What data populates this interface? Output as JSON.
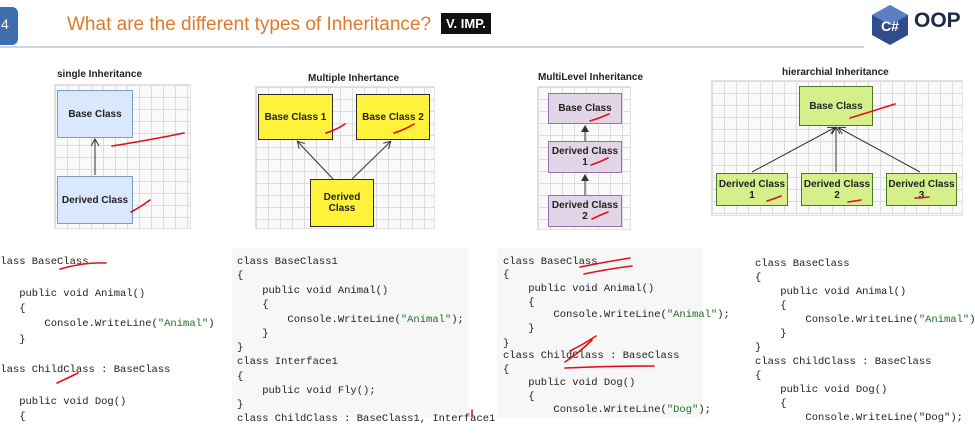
{
  "header": {
    "slide_number": "4",
    "title": "What are the different types of Inheritance?",
    "badge": "V. IMP.",
    "logo_letter": "C#",
    "logo_text": "OOP"
  },
  "diagrams": {
    "single": {
      "title": "single Inheritance",
      "base": "Base Class",
      "derived": "Derived Class"
    },
    "multiple": {
      "title": "Multiple Inhertance",
      "base1": "Base Class 1",
      "base2": "Base Class 2",
      "derived": "Derived Class"
    },
    "multilevel": {
      "title": "MultiLevel Inheritance",
      "base": "Base Class",
      "derived1": "Derived Class 1",
      "derived2": "Derived Class 2"
    },
    "hierarchical": {
      "title": "hierarchial Inheritance",
      "base": "Base Class",
      "derived1": "Derived Class 1",
      "derived2": "Derived Class 2",
      "derived3": "Derived Class 3"
    }
  },
  "code": {
    "c1": {
      "l1": "class BaseClass",
      "l2": "{",
      "l3": "    public void Animal()",
      "l4": "    {",
      "l5a": "        Console.WriteLine(",
      "l5s": "\"Animal\"",
      "l5b": ")",
      "l6": "    }",
      "l7": "}",
      "l8": "class ChildClass : BaseClass",
      "l9": "{",
      "l10": "    public void Dog()",
      "l11": "    {"
    },
    "c2": {
      "l1": "class BaseClass1",
      "l2": "{",
      "l3": "    public void Animal()",
      "l4": "    {",
      "l5a": "        Console.WriteLine(",
      "l5s": "\"Animal\"",
      "l5b": ");",
      "l6": "    }",
      "l7": "}",
      "l8": "class Interface1",
      "l9": "{",
      "l10": "    public void Fly();",
      "l11": "}",
      "l12": "class ChildClass : BaseClass1, Interface1"
    },
    "c3": {
      "l1": "class BaseClass",
      "l2": "{",
      "l3": "    public void Animal()",
      "l4": "    {",
      "l5a": "        Console.WriteLine(",
      "l5s": "\"Animal\"",
      "l5b": ");",
      "l6": "    }",
      "l7": "}",
      "l8": "class ChildClass : BaseClass",
      "l9": "{",
      "l10": "    public void Dog()",
      "l11": "    {",
      "l12a": "        Console.WriteLine(",
      "l12s": "\"Dog\"",
      "l12b": ");"
    },
    "c4": {
      "l1": "class BaseClass",
      "l2": "{",
      "l3": "    public void Animal()",
      "l4": "    {",
      "l5a": "        Console.WriteLine(",
      "l5s": "\"Animal\"",
      "l5b": ");",
      "l6": "    }",
      "l7": "}",
      "l8": "class ChildClass : BaseClass",
      "l9": "{",
      "l10": "    public void Dog()",
      "l11": "    {",
      "l12": "        Console.WriteLine(\"Dog\");"
    }
  },
  "colors": {
    "title": "#e07a2a",
    "blue_box": "#dae8fc",
    "yellow_box": "#fff23a",
    "purple_box": "#e1d5e7",
    "green_box": "#d5f08b",
    "annotation": "#e0101a"
  }
}
